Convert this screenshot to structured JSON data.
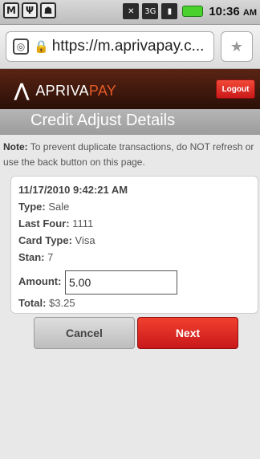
{
  "status_bar": {
    "time": "10:36",
    "ampm": "AM",
    "network": "3G",
    "icons": [
      "gmail-icon",
      "usb-icon",
      "android-icon",
      "mute-icon",
      "network-3g-icon",
      "signal-icon",
      "battery-icon"
    ]
  },
  "browser": {
    "url": "https://m.aprivapay.c..."
  },
  "header": {
    "brand_a": "APRIVA",
    "brand_b": "PAY",
    "logout_label": "Logout"
  },
  "page": {
    "title": "Credit Adjust Details",
    "note_label": "Note:",
    "note_text": " To prevent duplicate transactions, do NOT refresh or use the back button on this page."
  },
  "transaction": {
    "datetime": "11/17/2010 9:42:21 AM",
    "type_label": "Type:",
    "type_value": " Sale",
    "last_four_label": "Last Four:",
    "last_four_value": " 1111",
    "card_type_label": "Card Type:",
    "card_type_value": " Visa",
    "stan_label": "Stan:",
    "stan_value": " 7",
    "amount_label": "Amount:",
    "amount_value": "5.00",
    "total_label": "Total:",
    "total_value": " $3.25"
  },
  "actions": {
    "cancel_label": "Cancel",
    "next_label": "Next"
  },
  "colors": {
    "brand_orange": "#e45a27",
    "header_dark": "#2a0f07",
    "button_red": "#d9241f"
  }
}
